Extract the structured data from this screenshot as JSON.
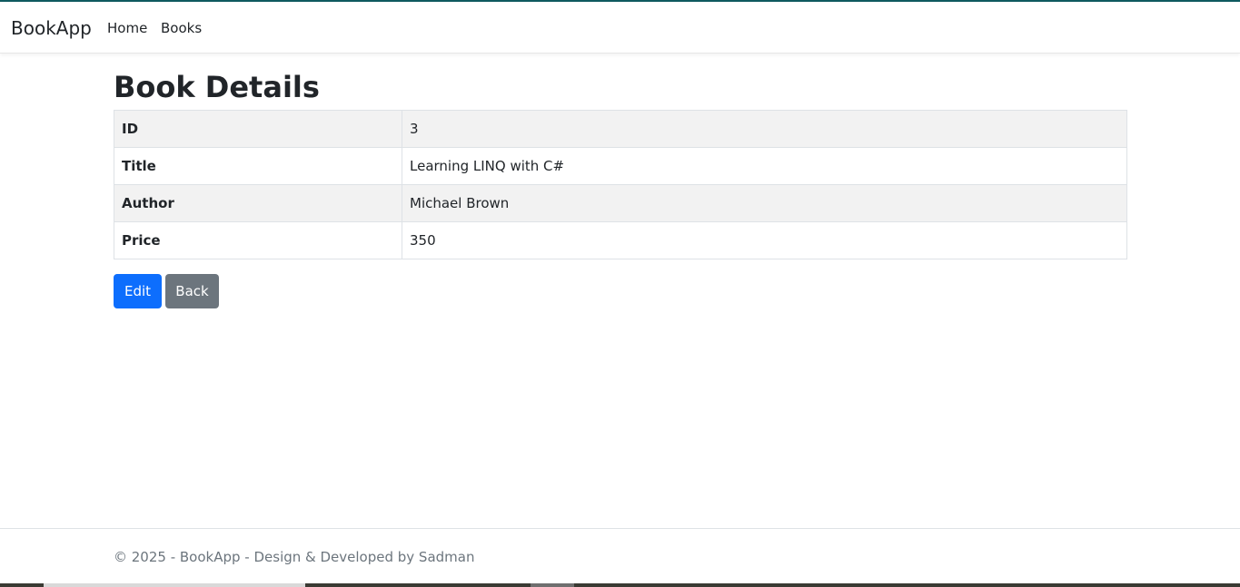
{
  "navbar": {
    "brand": "BookApp",
    "links": [
      {
        "label": "Home"
      },
      {
        "label": "Books"
      }
    ]
  },
  "page": {
    "title": "Book Details"
  },
  "details": {
    "rows": [
      {
        "key": "ID",
        "value": "3"
      },
      {
        "key": "Title",
        "value": "Learning LINQ with C#"
      },
      {
        "key": "Author",
        "value": "Michael Brown"
      },
      {
        "key": "Price",
        "value": "350"
      }
    ]
  },
  "actions": {
    "edit_label": "Edit",
    "back_label": "Back"
  },
  "footer": {
    "text": "© 2025 - BookApp - Design & Developed by Sadman"
  },
  "colors": {
    "primary": "#0d6efd",
    "secondary": "#6c757d",
    "stripe": "#f2f2f2",
    "top_accent": "#0f5a5f"
  }
}
